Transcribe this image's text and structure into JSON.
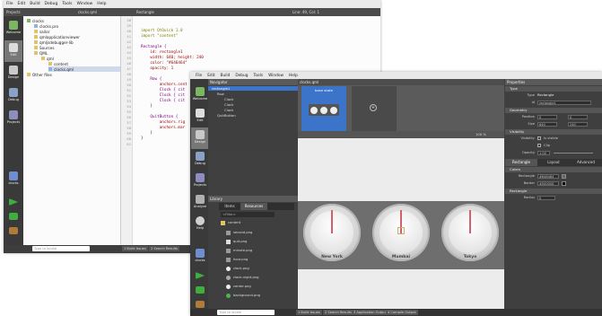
{
  "back_window": {
    "menu": [
      "File",
      "Edit",
      "Build",
      "Debug",
      "Tools",
      "Window",
      "Help"
    ],
    "toolbar": {
      "projects": "Projects",
      "filename": "clocks.qml",
      "symbol": "Rectangle",
      "position": "Line: 49, Col: 1"
    },
    "modes": [
      "Welcome",
      "Edit",
      "Design",
      "Debug",
      "Projects",
      "Analyze",
      "Help"
    ],
    "kit_label": "clocks",
    "kit_sub": "Qt 4.8 desktop",
    "project_tree": [
      {
        "label": "clocks",
        "level": 0
      },
      {
        "label": "clocks.pro",
        "level": 1
      },
      {
        "label": "sailor",
        "level": 1
      },
      {
        "label": "qmlapplicationviewer",
        "level": 1
      },
      {
        "label": "qmljsdebugger-lib",
        "level": 1
      },
      {
        "label": "Sources",
        "level": 1
      },
      {
        "label": "QML",
        "level": 1
      },
      {
        "label": "qml",
        "level": 2
      },
      {
        "label": "content",
        "level": 3
      },
      {
        "label": "clocks.qml",
        "level": 3
      },
      {
        "label": "Other files",
        "level": 0
      }
    ],
    "line_numbers": [
      "38",
      "39",
      "40",
      "41",
      "42",
      "43",
      "44",
      "45",
      "46",
      "47",
      "48",
      "49",
      "50",
      "51",
      "52",
      "53",
      "54",
      "55",
      "56",
      "57",
      "58",
      "59",
      "60",
      "61"
    ],
    "code": {
      "import1": "import QtQuick 1.0",
      "import2": "import \"content\"",
      "rect_open": "Rectangle {",
      "id_line": "    id: rectangle1",
      "size_line": "    width: 640; height: 240",
      "color_line": "    color: \"#646464\"",
      "opacity_line": "    opacity: 1",
      "row_open": "    Row {",
      "anchors1": "        anchors.cent",
      "clock1": "        Clock { cit",
      "clock2": "        Clock { cit",
      "clock3": "        Clock { cit",
      "row_close": "    }",
      "quit_open": "    QuitButton {",
      "anchors2": "        anchors.rig",
      "anchors3": "        anchors.mar",
      "quit_close": "    }",
      "rect_close": "}"
    },
    "status": {
      "locator": "Type to locate",
      "b1": "1 Build Issues",
      "b2": "2 Search Results"
    }
  },
  "front_window": {
    "menu": [
      "File",
      "Edit",
      "Build",
      "Debug",
      "Tools",
      "Window",
      "Help"
    ],
    "navigator_title": "Navigator",
    "navigator": [
      {
        "label": "rectangle1",
        "level": 0,
        "selected": true
      },
      {
        "label": "Row",
        "level": 1
      },
      {
        "label": "Clock",
        "level": 2
      },
      {
        "label": "Clock",
        "level": 2
      },
      {
        "label": "Clock",
        "level": 2
      },
      {
        "label": "QuitButton",
        "level": 1
      }
    ],
    "tab_filename": "clocks.qml",
    "state_label": "base state",
    "zoom": "100 %",
    "library_title": "Library",
    "library_tabs": [
      "Items",
      "Resources"
    ],
    "library_path": "<Filter>",
    "library_items": [
      "content",
      "second.png",
      "quit.png",
      "minute.png",
      "hour.png",
      "clock.png",
      "clock-night.png",
      "center.png",
      "background.png"
    ],
    "cities": [
      "New York",
      "Mumbai",
      "Tokyo"
    ],
    "hand_angles": [
      0,
      0,
      0
    ],
    "properties": {
      "title": "Properties",
      "type_section": "Type",
      "type_label": "Type",
      "type_value": "Rectangle",
      "id_label": "id",
      "id_value": "rectangle1",
      "geometry_section": "Geometry",
      "position_label": "Position",
      "pos_x": "0",
      "pos_y": "0",
      "size_label": "Size",
      "size_w": "640",
      "size_h": "240",
      "visibility_section": "Visibility",
      "visibility_label": "Visibility",
      "is_visible": "Is visible",
      "clip": "Clip",
      "opacity_label": "Opacity",
      "opacity_value": "1.00",
      "tabs": [
        "Rectangle",
        "Layout",
        "Advanced"
      ],
      "colors_section": "Colors",
      "rect_label": "Rectangle",
      "rect_color": "#646464",
      "border_label": "Border",
      "border_color": "#000000",
      "rectangle_section": "Rectangle",
      "radius_label": "Radius",
      "radius_value": "0"
    },
    "status": {
      "locator": "Type to locate",
      "b1": "1 Build Issues",
      "b2": "2 Search Results",
      "b3": "3 Application Output",
      "b4": "4 Compile Output"
    }
  },
  "colors": {
    "accent": "#3b74c9",
    "dark_panel": "#404040",
    "canvas": "#ececec",
    "hand": "#d45f6f"
  }
}
